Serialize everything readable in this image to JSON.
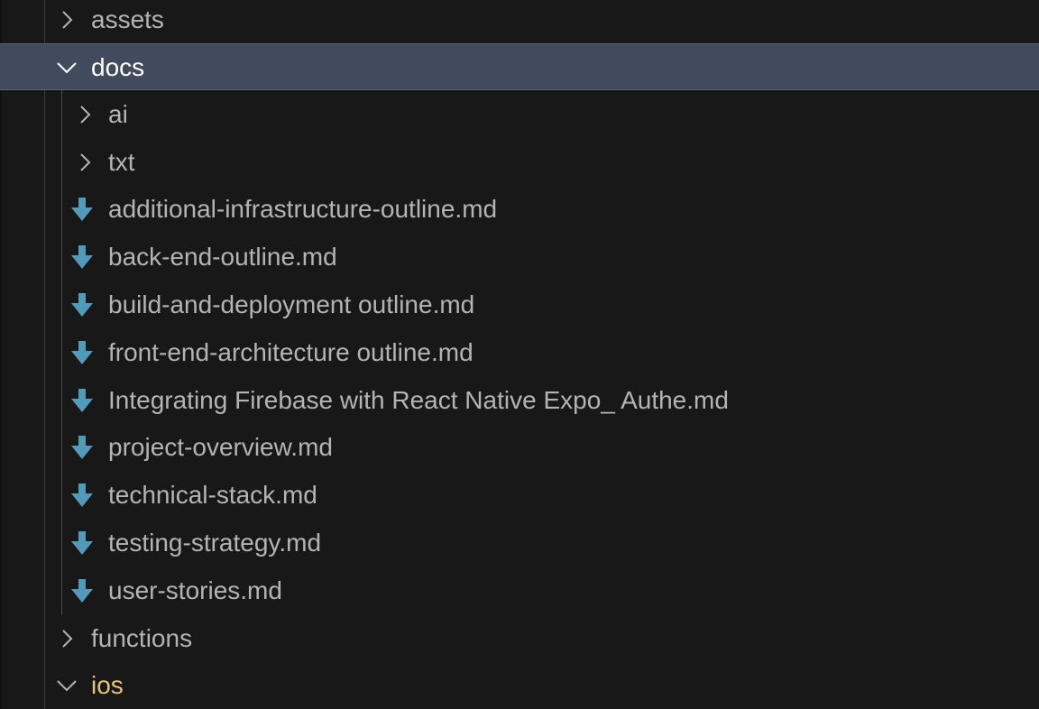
{
  "explorer": {
    "rows": [
      {
        "label": "assets",
        "type": "folder",
        "expanded": false,
        "depth": 0
      },
      {
        "label": "docs",
        "type": "folder",
        "expanded": true,
        "depth": 0,
        "selected": true
      },
      {
        "label": "ai",
        "type": "folder",
        "expanded": false,
        "depth": 1
      },
      {
        "label": "txt",
        "type": "folder",
        "expanded": false,
        "depth": 1
      },
      {
        "label": "additional-infrastructure-outline.md",
        "type": "file",
        "depth": 1
      },
      {
        "label": "back-end-outline.md",
        "type": "file",
        "depth": 1
      },
      {
        "label": "build-and-deployment outline.md",
        "type": "file",
        "depth": 1
      },
      {
        "label": "front-end-architecture outline.md",
        "type": "file",
        "depth": 1
      },
      {
        "label": "Integrating Firebase with React Native Expo_ Authe.md",
        "type": "file",
        "depth": 1
      },
      {
        "label": "project-overview.md",
        "type": "file",
        "depth": 1
      },
      {
        "label": "technical-stack.md",
        "type": "file",
        "depth": 1
      },
      {
        "label": "testing-strategy.md",
        "type": "file",
        "depth": 1
      },
      {
        "label": "user-stories.md",
        "type": "file",
        "depth": 1
      },
      {
        "label": "functions",
        "type": "folder",
        "expanded": false,
        "depth": 0
      },
      {
        "label": "ios",
        "type": "folder",
        "expanded": true,
        "depth": 0
      }
    ]
  },
  "icons": {
    "folder_collapsed": "chevron-right-icon",
    "folder_expanded": "chevron-down-icon",
    "markdown_file": "markdown-download-arrow-icon"
  },
  "colors": {
    "background": "#181818",
    "selected_row": "#424b5d",
    "text": "#b4b4b4",
    "selected_text": "#ffffff",
    "markdown_icon": "#519aba",
    "ios_folder_text": "#e8c17a"
  }
}
